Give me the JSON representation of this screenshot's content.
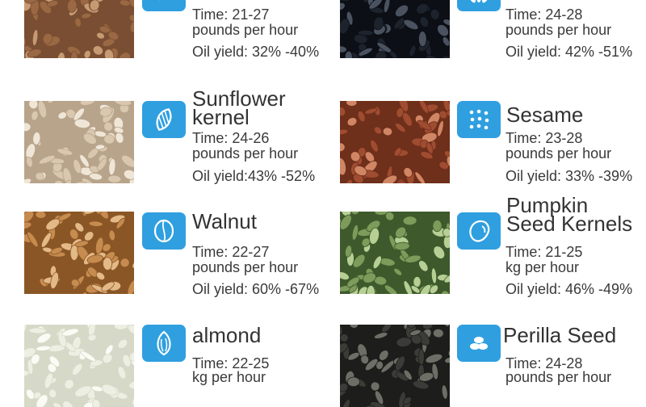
{
  "items": [
    {
      "name_lines": [],
      "time": "Time: 21-27",
      "rate": "pounds per hour",
      "oil_yield": "Oil yield: 32% -40%",
      "icon": "kernel-pile-icon",
      "photo": "peanut-kernels-photo",
      "colors": {
        "base": "#7a4e32",
        "seed": "#9a6843",
        "hi": "#c69a73"
      }
    },
    {
      "name_lines": [],
      "time": "Time: 24-28",
      "rate": "pounds per hour",
      "oil_yield": "Oil yield: 42% -51%",
      "icon": "seed-cluster-icon",
      "photo": "black-sesame-photo",
      "colors": {
        "base": "#0c0f15",
        "seed": "#1d232d",
        "hi": "#4a5260"
      }
    },
    {
      "name_lines": [
        "Sunflower",
        "kernel"
      ],
      "time": "Time: 24-26",
      "rate": "pounds per hour",
      "oil_yield": "Oil yield:43% -52%",
      "icon": "sunflower-seed-icon",
      "photo": "sunflower-kernels-photo",
      "colors": {
        "base": "#b8a48b",
        "seed": "#d9c8af",
        "hi": "#efe6d7"
      }
    },
    {
      "name_lines": [
        "Sesame"
      ],
      "time": "Time: 23-28",
      "rate": "pounds per hour",
      "oil_yield": "Oil yield: 33% -39%",
      "icon": "sesame-dots-icon",
      "photo": "flax-seeds-photo",
      "colors": {
        "base": "#6e2f1b",
        "seed": "#a04c31",
        "hi": "#d08664"
      }
    },
    {
      "name_lines": [
        "Walnut"
      ],
      "time": "Time: 22-27",
      "rate": "pounds per hour",
      "oil_yield": "Oil yield: 60% -67%",
      "icon": "walnut-icon",
      "photo": "walnut-kernels-photo",
      "colors": {
        "base": "#8a5626",
        "seed": "#c68b4e",
        "hi": "#e3b987"
      }
    },
    {
      "name_lines": [
        "Pumpkin",
        "Seed Kernels"
      ],
      "time": "Time: 21-25",
      "rate": "kg per hour",
      "oil_yield": "Oil yield: 46% -49%",
      "icon": "pumpkin-seed-icon",
      "photo": "pumpkin-seeds-photo",
      "colors": {
        "base": "#3e5a2c",
        "seed": "#7d9b5a",
        "hi": "#b7cf94"
      }
    },
    {
      "name_lines": [
        "almond"
      ],
      "time": "Time: 22-25",
      "rate": "kg per hour",
      "oil_yield": "",
      "icon": "almond-icon",
      "photo": "blanched-almonds-photo",
      "colors": {
        "base": "#d7d9c8",
        "seed": "#eeefe3",
        "hi": "#fbfbf5"
      }
    },
    {
      "name_lines": [
        "Perilla Seed"
      ],
      "time": "Time: 24-28",
      "rate": "pounds per hour",
      "oil_yield": "",
      "icon": "leaf-seeds-icon",
      "photo": "perilla-seeds-photo",
      "colors": {
        "base": "#1d1d1b",
        "seed": "#3b3c37",
        "hi": "#6d6e66"
      }
    }
  ],
  "accent": "#2f9fe0"
}
